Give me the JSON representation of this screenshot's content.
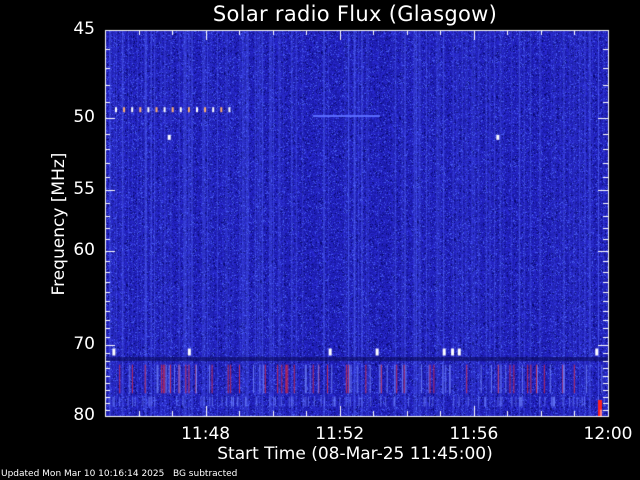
{
  "chart_data": {
    "type": "heatmap",
    "title": "Solar radio Flux (Glasgow)",
    "ylabel": "Frequency [MHz]",
    "xlabel": "Start Time (08-Mar-25 11:45:00)",
    "x_tick_labels": [
      "11:48",
      "11:52",
      "11:56",
      "12:00"
    ],
    "x_ticks_minutes": [
      3,
      7,
      11,
      15
    ],
    "xlim_minutes": [
      0,
      15
    ],
    "y_tick_labels": [
      "45",
      "50",
      "55",
      "60",
      "70",
      "80"
    ],
    "y_ticks": [
      45,
      50,
      55,
      60,
      70,
      80
    ],
    "ylim": [
      45,
      80
    ],
    "yscale": "reciprocal",
    "colors": {
      "background": "#1a1aa8",
      "hot": "#ff2020",
      "bright": "#ffffff"
    }
  },
  "footer": {
    "updated": "Updated Mon Mar 10 10:16:14 2025",
    "note": "BG subtracted"
  }
}
